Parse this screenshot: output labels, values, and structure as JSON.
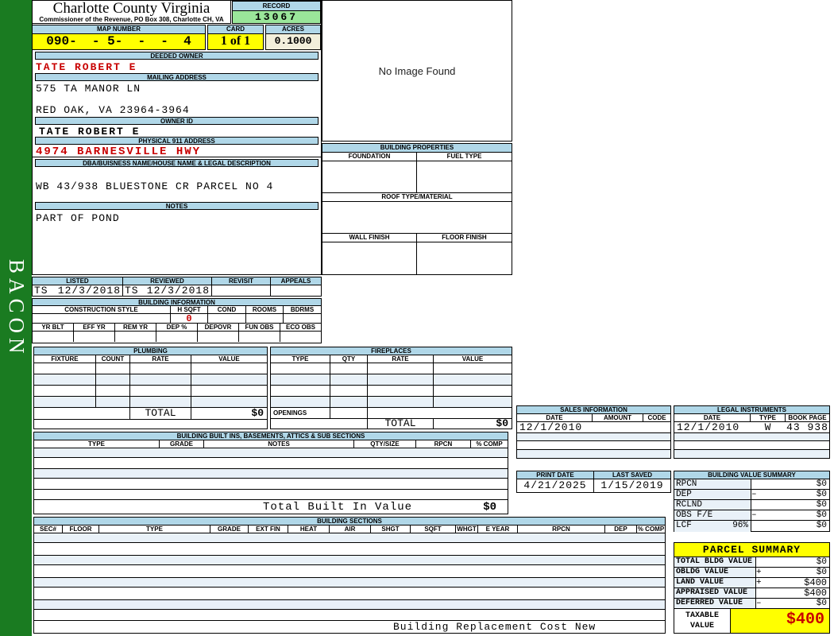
{
  "title_block": {
    "county": "Charlotte County Virginia",
    "subtitle": "Commissioner of the Revenue, PO Box 308, Charlotte CH, VA"
  },
  "record": {
    "label": "RECORD",
    "value": "13067"
  },
  "map": {
    "label": "MAP NUMBER",
    "value": "090-  - 5-  -  -  4"
  },
  "card": {
    "label": "CARD",
    "value": "1 of 1"
  },
  "acres": {
    "label": "ACRES",
    "value": "0.1000"
  },
  "owner": {
    "deeded_owner_label": "DEEDED OWNER",
    "deeded_owner": "TATE ROBERT E",
    "mailing_address_label": "MAILING ADDRESS",
    "mailing_line1": "575 TA MANOR LN",
    "mailing_line2": "RED OAK, VA 23964-3964",
    "owner_id_label": "OWNER ID",
    "owner_id": "TATE ROBERT E",
    "physical_address_label": "PHYSICAL 911 ADDRESS",
    "physical_address": "4974 BARNESVILLE HWY",
    "dba_label": "DBA/BUISNESS NAME/HOUSE NAME & LEGAL DESCRIPTION",
    "legal_description": "WB 43/938 BLUESTONE CR PARCEL NO 4",
    "notes_label": "NOTES",
    "notes": "PART OF POND"
  },
  "review": {
    "listed_label": "LISTED",
    "reviewed_label": "REVIEWED",
    "revisit_label": "REVISIT",
    "appeals_label": "APPEALS",
    "listed_by": "TS",
    "listed_date": "12/3/2018",
    "reviewed_by": "TS",
    "reviewed_date": "12/3/2018",
    "revisit": "",
    "appeals": ""
  },
  "building_information": {
    "title": "BUILDING INFORMATION",
    "construction_style_label": "CONSTRUCTION STYLE",
    "h_sqft_label": "H SQFT",
    "cond_label": "COND",
    "rooms_label": "ROOMS",
    "bdrms_label": "BDRMS",
    "h_sqft_value": "0",
    "yr_blt_label": "YR BLT",
    "eff_yr_label": "EFF YR",
    "rem_yr_label": "REM YR",
    "dep_label": "DEP %",
    "depovr_label": "DEPOVR",
    "fun_obs_label": "FUN OBS",
    "eco_obs_label": "ECO OBS"
  },
  "building_properties": {
    "title": "BUILDING PROPERTIES",
    "foundation_label": "FOUNDATION",
    "fuel_type_label": "FUEL TYPE",
    "roof_label": "ROOF TYPE/MATERIAL",
    "wall_finish_label": "WALL FINISH",
    "floor_finish_label": "FLOOR FINISH"
  },
  "plumbing": {
    "title": "PLUMBING",
    "headers": [
      "FIXTURE",
      "COUNT",
      "RATE",
      "VALUE"
    ],
    "total_label": "TOTAL",
    "total_value": "$0"
  },
  "fireplaces": {
    "title": "FIREPLACES",
    "headers": [
      "TYPE",
      "QTY",
      "RATE",
      "VALUE"
    ],
    "openings_label": "OPENINGS",
    "total_label": "TOTAL",
    "total_value": "$0"
  },
  "built_ins": {
    "title": "BUILDING BUILT INS, BASEMENTS, ATTICS & SUB SECTIONS",
    "headers": [
      "TYPE",
      "GRADE",
      "NOTES",
      "QTY/SIZE",
      "RPCN",
      "% COMP"
    ],
    "total_label": "Total Built In Value",
    "total_value": "$0"
  },
  "building_sections": {
    "title": "BUILDING SECTIONS",
    "headers": [
      "SEC#",
      "FLOOR",
      "TYPE",
      "GRADE",
      "EXT FIN",
      "HEAT",
      "AIR",
      "SHGT",
      "SQFT",
      "WHGT",
      "E YEAR",
      "RPCN",
      "DEP",
      "% COMP"
    ],
    "footer": "Building Replacement Cost New"
  },
  "sales_information": {
    "title": "SALES INFORMATION",
    "headers": [
      "DATE",
      "AMOUNT",
      "CODE"
    ],
    "rows": [
      {
        "date": "12/1/2010",
        "amount": "",
        "code": ""
      }
    ]
  },
  "legal_instruments": {
    "title": "LEGAL INSTRUMENTS",
    "headers": [
      "DATE",
      "TYPE",
      "BOOK PAGE"
    ],
    "rows": [
      {
        "date": "12/1/2010",
        "type": "W",
        "book_page": "43 938"
      }
    ]
  },
  "print_info": {
    "print_date_label": "PRINT DATE",
    "print_date": "4/21/2025",
    "last_saved_label": "LAST SAVED",
    "last_saved": "1/15/2019"
  },
  "building_value_summary": {
    "title": "BUILDING VALUE SUMMARY",
    "rows": [
      {
        "label": "RPCN",
        "op": "",
        "value": "$0"
      },
      {
        "label": "DEP",
        "op": "–",
        "value": "$0"
      },
      {
        "label": "RCLND",
        "op": "",
        "value": "$0"
      },
      {
        "label": "OBS F/E",
        "op": "–",
        "value": "$0"
      },
      {
        "label": "LCF",
        "pct": "96%",
        "op": "",
        "value": "$0"
      }
    ]
  },
  "parcel_summary": {
    "title": "PARCEL SUMMARY",
    "rows": [
      {
        "label": "TOTAL BLDG VALUE",
        "op": "",
        "value": "$0"
      },
      {
        "label": "OBLDG VALUE",
        "op": "+",
        "value": "$0"
      },
      {
        "label": "LAND VALUE",
        "op": "+",
        "value": "$400"
      },
      {
        "label": "APPRAISED VALUE",
        "op": "",
        "value": "$400"
      },
      {
        "label": "DEFERRED VALUE",
        "op": "–",
        "value": "$0"
      }
    ],
    "taxable_label_line1": "TAXABLE",
    "taxable_label_line2": "VALUE",
    "taxable_value": "$400"
  },
  "image_box": {
    "placeholder": "No Image Found"
  },
  "sidebar": {
    "watermark": "BACON"
  },
  "colors": {
    "header_bar_blue": "#b0d7e8",
    "row_stripe": "#e9f1f8",
    "highlight_yellow": "#ffff00",
    "record_green": "#9ae69a",
    "acres_beige": "#f2efdb",
    "sidebar_green": "#1a7b21",
    "alert_red": "#c80000"
  }
}
